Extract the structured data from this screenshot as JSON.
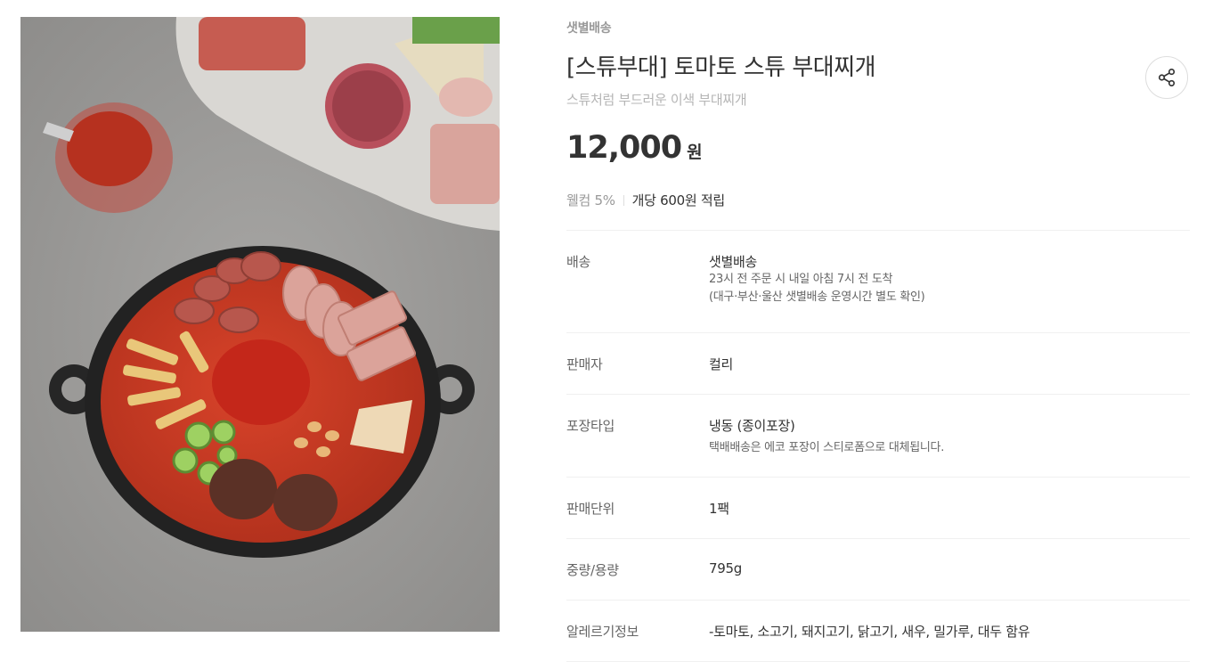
{
  "product": {
    "badge": "샛별배송",
    "title": "[스튜부대] 토마토 스튜 부대찌개",
    "subtitle": "스튜처럼 부드러운 이색 부대찌개",
    "price": "12,000",
    "price_unit": "원",
    "points_welcome": "웰컴 5%",
    "points_reward": "개당 600원 적립"
  },
  "share": {
    "icon": "share-icon"
  },
  "details": [
    {
      "label": "배송",
      "value": "샛별배송",
      "sub": [
        "23시 전 주문 시 내일 아침 7시 전 도착",
        "(대구·부산·울산 샛별배송 운영시간 별도 확인)"
      ]
    },
    {
      "label": "판매자",
      "value": "컬리"
    },
    {
      "label": "포장타입",
      "value": "냉동 (종이포장)",
      "sub": [
        "택배배송은 에코 포장이 스티로폼으로 대체됩니다."
      ]
    },
    {
      "label": "판매단위",
      "value": "1팩"
    },
    {
      "label": "중량/용량",
      "value": "795g"
    },
    {
      "label": "알레르기정보",
      "value": "-토마토, 소고기, 돼지고기, 닭고기, 새우, 밀가루, 대두 함유"
    }
  ]
}
